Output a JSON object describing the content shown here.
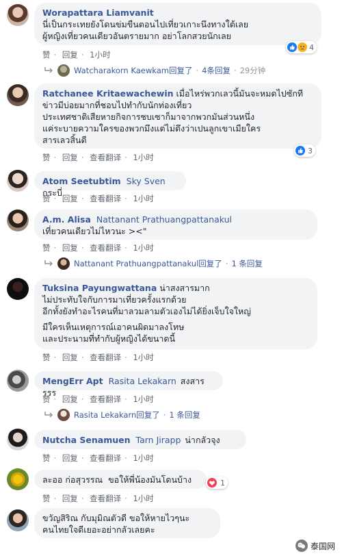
{
  "actions": {
    "like": "赞",
    "reply": "回复",
    "translate": "查看翻译"
  },
  "colors": {
    "link": "#385898",
    "bubble": "#f2f3f5",
    "like_blue": "#1877f2",
    "love_red": "#f33e58",
    "sad_yellow": "#f7b125"
  },
  "comments": [
    {
      "name": "Worapattara Liamvanit",
      "tag": "",
      "lines": [
        "นี่เป็นกระเทยยังโดนข่มขืนตอนไปเที่ยวเกาะนึงทางใต้เลย",
        "ผู้หญิงเที่ยวคนเดียวอันตรายมาก อย่าโลกสวยนักเลย"
      ],
      "time": "1小时",
      "show_translate": false,
      "reactions": {
        "icons": [
          "like-icon",
          "sad-icon"
        ],
        "count": "4"
      },
      "reply": {
        "name": "Watcharakorn Kaewkam",
        "verb": "回复了",
        "count": "4条回复",
        "time": "29分钟"
      }
    },
    {
      "name": "Ratchanee Kritaewachewin",
      "tag": "",
      "lines": [
        "เมื่อไหร่พวกเลวนี้มันจะหมดไปซักที",
        "ข่าวมีบ่อยมากที่ชอบไปทำกับนักท่องเที่ยว",
        "ประเทศชาติเสียหายกิจการชบเซาก็มาจากพวกมันส่วนหนึ่ง",
        "แค่ระบายความใครของพวกมึงแต่ไม่ดึงว่าเปนลูกเขาเมียใคร",
        "สารเลวสิ้นดี"
      ],
      "time": "1小时",
      "show_translate": true,
      "reactions": {
        "icons": [
          "like-icon"
        ],
        "count": "3"
      },
      "reply": null
    },
    {
      "name": "Atom Seetubtim",
      "tag": "Sky Sven",
      "lines": [
        "กระบี่"
      ],
      "time": "1小时",
      "show_translate": true,
      "reactions": null,
      "reply": null
    },
    {
      "name": "A.m. Alisa",
      "tag": "Nattanant Prathuangpattanakul",
      "lines": [
        "เที่ยวคนเดียวไม่ไหวนะ ><\""
      ],
      "time": "1小时",
      "show_translate": true,
      "reactions": null,
      "reply": {
        "name": "Nattanant Prathuangpattanakul",
        "verb": "回复了",
        "count": "1 条回复",
        "time": ""
      }
    },
    {
      "name": "Tuksina Payungwattana",
      "tag": "",
      "lines": [
        "น่าสงสารมาก",
        "ไม่ประทับใจกับการมาเที่ยวครั้งแรกด้วย",
        "อีกทั้งยังทำอะไรคนที่มาลวมลามตัวเองไม่ได้ยิ่งเจ็บใจใหญ่",
        "",
        "มีใครเห็นเหตุการณ์เอาคนผิดมาลงโทษ",
        "และประนามที่ทำกับผู้หญิงได้ขนาดนี้"
      ],
      "time": "1小时",
      "show_translate": true,
      "reactions": null,
      "reply": null
    },
    {
      "name": "MengErr Apt",
      "tag": "Rasita Lekakarn",
      "lines": [
        "สงสารรรร"
      ],
      "time": "1小时",
      "show_translate": true,
      "reactions": null,
      "reply": {
        "name": "Rasita Lekakarn",
        "verb": "回复了",
        "count": "1 条回复",
        "time": ""
      }
    },
    {
      "name": "Nutcha Senamuen",
      "tag": "Tarn Jirapp",
      "lines": [
        "น่ากลัวจุง"
      ],
      "time": "1小时",
      "show_translate": true,
      "reactions": null,
      "reply": null
    },
    {
      "name": "ละออ ก่อสุวรรณ",
      "tag": "",
      "lines": [
        "ขอให้พี่น้องมันโดนบ้าง"
      ],
      "time": "1小时",
      "show_translate": true,
      "reactions": {
        "icons": [
          "love-icon"
        ],
        "count": "1"
      },
      "reply": null
    },
    {
      "name": "ขวัญสิริณ กับมุมิณตัวดี",
      "tag": "",
      "lines": [
        "ขอให้หายไวๆนะ",
        "คนไทยใจดีเยอะอย่ากลัวเลยคะ"
      ],
      "time": "",
      "show_translate": false,
      "reactions": null,
      "reply": null
    }
  ],
  "watermark": "泰国网"
}
